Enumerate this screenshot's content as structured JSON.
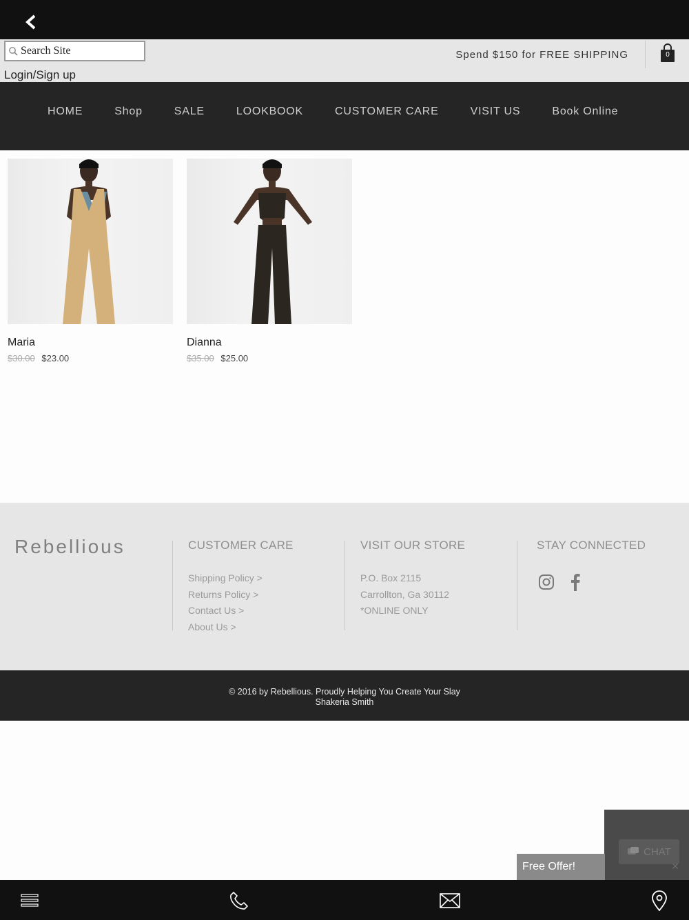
{
  "header": {
    "search_placeholder": "Search Site",
    "login_label": "Login/Sign up",
    "shipping_text": "Spend $150 for FREE SHIPPING",
    "cart_count": "0"
  },
  "nav": {
    "items": [
      "HOME",
      "Shop",
      "SALE",
      "LOOKBOOK",
      "CUSTOMER CARE",
      "VISIT US",
      "Book Online"
    ]
  },
  "products": [
    {
      "name": "Maria",
      "old_price": "$30.00",
      "price": "$23.00",
      "garment_color": "#d4b07a"
    },
    {
      "name": "Dianna",
      "old_price": "$35.00",
      "price": "$25.00",
      "garment_color": "#2b2620"
    }
  ],
  "footer": {
    "brand": "Rebellious",
    "customer_care": {
      "heading": "CUSTOMER CARE",
      "links": [
        "Shipping Policy >",
        "Returns Policy >",
        "Contact Us >",
        "About Us >"
      ]
    },
    "visit": {
      "heading": "VISIT OUR STORE",
      "lines": [
        "P.O. Box 2115",
        "Carrollton, Ga 30112",
        "*ONLINE ONLY"
      ]
    },
    "stay_connected": {
      "heading": "STAY CONNECTED",
      "icons": [
        "instagram-icon",
        "facebook-icon"
      ]
    },
    "copyright_line1": "© 2016 by Rebellious. Proudly Helping You Create Your Slay",
    "copyright_line2": "Shakeria Smith"
  },
  "widgets": {
    "free_offer": "Free Offer!",
    "chat_label": "CHAT"
  },
  "bottom_bar": {
    "icons": [
      "menu-icon",
      "phone-icon",
      "email-icon",
      "location-pin-icon"
    ]
  },
  "colors": {
    "top_bar": "#111111",
    "nav_bg": "#252525",
    "utility_bg": "#e6e6e6",
    "footer_bg": "#e6e6e6"
  }
}
